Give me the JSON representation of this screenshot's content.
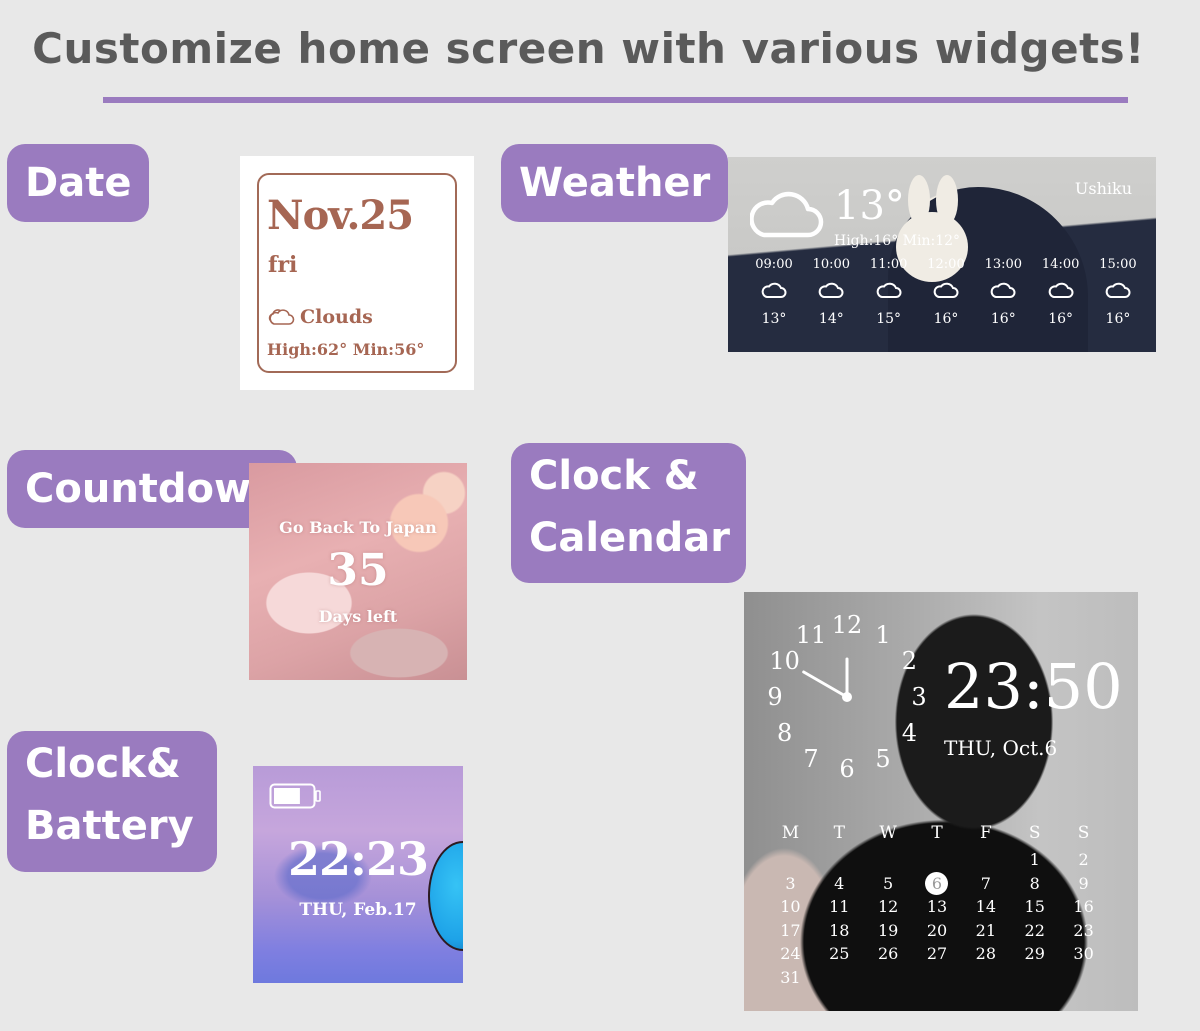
{
  "header": {
    "title": "Customize home screen with various widgets!",
    "accent_color": "#9a7bbf"
  },
  "labels": {
    "date": "Date",
    "weather": "Weather",
    "countdown": "Countdown",
    "clock_calendar_line1": "Clock &",
    "clock_calendar_line2": "Calendar",
    "clock_battery_line1": "Clock&",
    "clock_battery_line2": "Battery"
  },
  "date_widget": {
    "date": "Nov.25",
    "weekday": "fri",
    "condition_icon": "cloud-icon",
    "condition": "Clouds",
    "high_low": "High:62° Min:56°",
    "text_color": "#a66653"
  },
  "weather_widget": {
    "city": "Ushiku",
    "current_icon": "cloud-icon",
    "current_temp": "13°",
    "high_low": "High:16° Min:12°",
    "hourly": [
      {
        "time": "09:00",
        "icon": "cloud-icon",
        "temp": "13°"
      },
      {
        "time": "10:00",
        "icon": "cloud-icon",
        "temp": "14°"
      },
      {
        "time": "11:00",
        "icon": "cloud-icon",
        "temp": "15°"
      },
      {
        "time": "12:00",
        "icon": "cloud-icon",
        "temp": "16°"
      },
      {
        "time": "13:00",
        "icon": "cloud-icon",
        "temp": "16°"
      },
      {
        "time": "14:00",
        "icon": "cloud-icon",
        "temp": "16°"
      },
      {
        "time": "15:00",
        "icon": "cloud-icon",
        "temp": "16°"
      }
    ]
  },
  "countdown_widget": {
    "event": "Go Back To Japan",
    "count": "35",
    "unit": "Days left"
  },
  "battery_widget": {
    "battery_icon": "battery-icon",
    "battery_level": 0.7,
    "time": "22:23",
    "date": "THU, Feb.17"
  },
  "calendar_widget": {
    "analog_time": "10:00",
    "dial_numbers": [
      "12",
      "1",
      "2",
      "3",
      "4",
      "5",
      "6",
      "7",
      "8",
      "9",
      "10",
      "11"
    ],
    "digital_time": "23:50",
    "date": "THU, Oct.6",
    "weekdays": [
      "M",
      "T",
      "W",
      "T",
      "F",
      "S",
      "S"
    ],
    "leading_blanks": 5,
    "days": [
      "1",
      "2",
      "3",
      "4",
      "5",
      "6",
      "7",
      "8",
      "9",
      "10",
      "11",
      "12",
      "13",
      "14",
      "15",
      "16",
      "17",
      "18",
      "19",
      "20",
      "21",
      "22",
      "23",
      "24",
      "25",
      "26",
      "27",
      "28",
      "29",
      "30",
      "31"
    ],
    "today": "6"
  }
}
